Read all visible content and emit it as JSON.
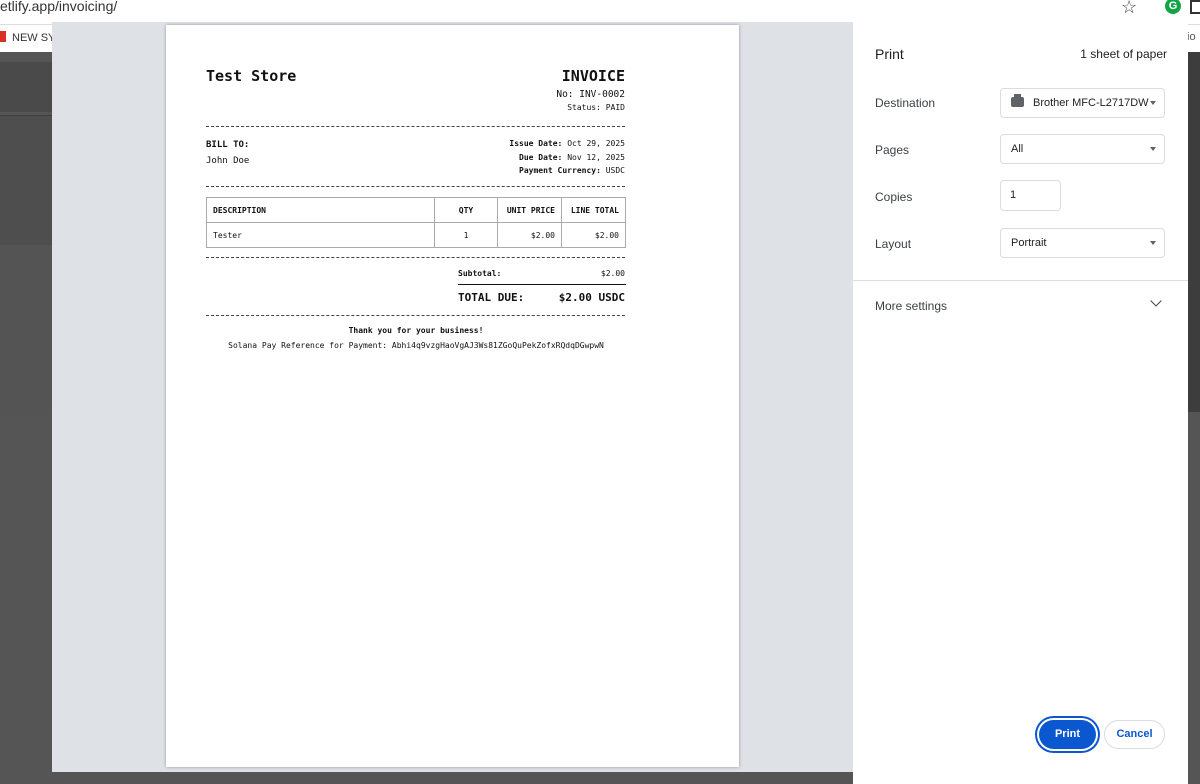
{
  "browser": {
    "url": "etlify.app/invoicing/",
    "bookmark_label": "NEW SY",
    "bookmark_right": "io"
  },
  "invoice": {
    "store_name": "Test Store",
    "title": "INVOICE",
    "number": "No: INV-0002",
    "status": "Status: PAID",
    "bill_to_label": "BILL TO:",
    "bill_to_name": "John Doe",
    "issue_date_label": "Issue Date:",
    "issue_date": "Oct 29, 2025",
    "due_date_label": "Due Date:",
    "due_date": "Nov 12, 2025",
    "currency_label": "Payment Currency:",
    "currency": "USDC",
    "columns": [
      "DESCRIPTION",
      "QTY",
      "UNIT PRICE",
      "LINE TOTAL"
    ],
    "items": [
      {
        "description": "Tester",
        "qty": "1",
        "unit_price": "$2.00",
        "line_total": "$2.00"
      }
    ],
    "subtotal_label": "Subtotal:",
    "subtotal": "$2.00",
    "total_label": "TOTAL DUE:",
    "total": "$2.00 USDC",
    "thanks": "Thank you for your business!",
    "reference": "Solana Pay Reference for Payment: Abhi4q9vzgHaoVgAJ3Ws81ZGoQuPekZofxRQdqDGwpwN"
  },
  "print_panel": {
    "title": "Print",
    "sheets": "1 sheet of paper",
    "destination_label": "Destination",
    "destination_value": "Brother MFC-L2717DW",
    "pages_label": "Pages",
    "pages_value": "All",
    "copies_label": "Copies",
    "copies_value": "1",
    "layout_label": "Layout",
    "layout_value": "Portrait",
    "more_settings": "More settings",
    "print_button": "Print",
    "cancel_button": "Cancel"
  },
  "icons": {
    "star": "star-icon",
    "extension": "grammarly-icon",
    "printer": "printer-icon",
    "chevron": "chevron-down-icon"
  }
}
